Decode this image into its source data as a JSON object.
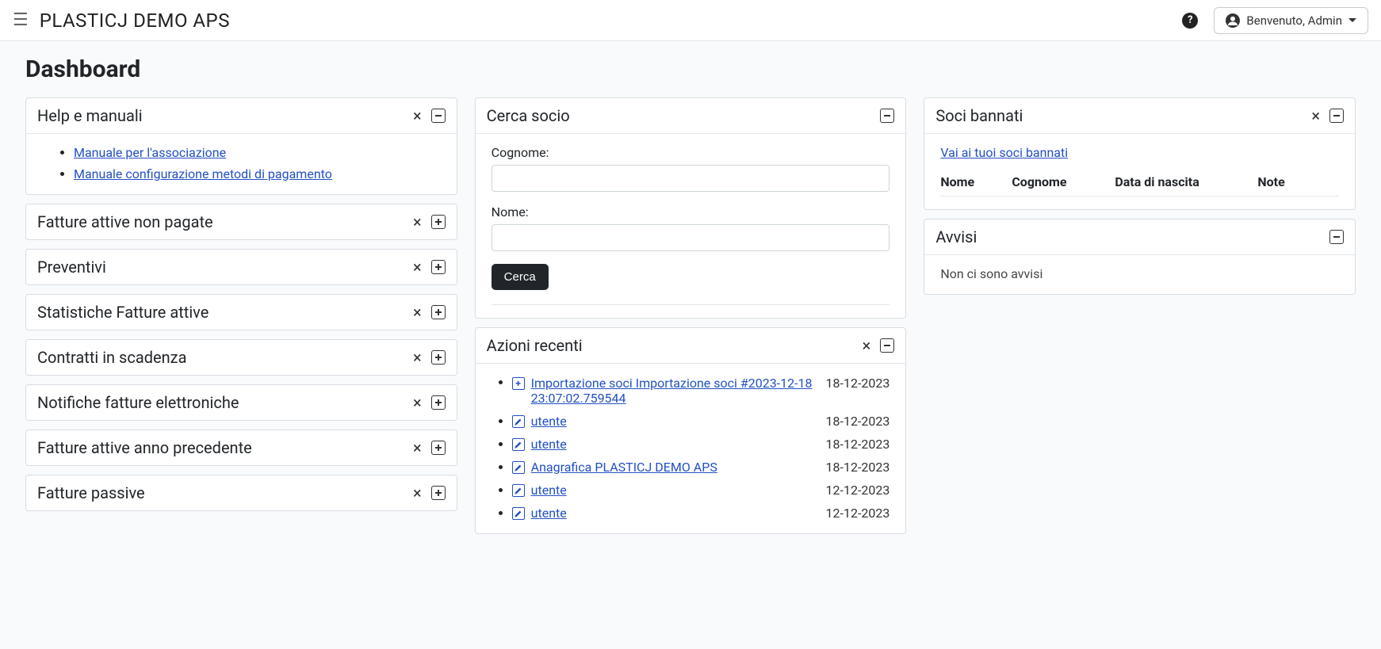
{
  "app_title": "PLASTICJ DEMO APS",
  "user_greeting": "Benvenuto, Admin",
  "page_heading": "Dashboard",
  "panels": {
    "help": {
      "title": "Help e manuali",
      "links": [
        "Manuale per l'associazione",
        "Manuale configurazione metodi di pagamento"
      ]
    },
    "collapsed": [
      "Fatture attive non pagate",
      "Preventivi",
      "Statistiche Fatture attive",
      "Contratti in scadenza",
      "Notifiche fatture elettroniche",
      "Fatture attive anno precedente",
      "Fatture passive"
    ],
    "search_member": {
      "title": "Cerca socio",
      "label_surname": "Cognome:",
      "label_name": "Nome:",
      "button": "Cerca"
    },
    "recent_actions": {
      "title": "Azioni recenti",
      "items": [
        {
          "icon": "add",
          "label": "Importazione soci Importazione soci #2023-12-18 23:07:02.759544",
          "date": "18-12-2023"
        },
        {
          "icon": "edit",
          "label": "utente",
          "date": "18-12-2023"
        },
        {
          "icon": "edit",
          "label": "utente",
          "date": "18-12-2023"
        },
        {
          "icon": "edit",
          "label": "Anagrafica PLASTICJ DEMO APS",
          "date": "18-12-2023"
        },
        {
          "icon": "edit",
          "label": "utente",
          "date": "12-12-2023"
        },
        {
          "icon": "edit",
          "label": "utente",
          "date": "12-12-2023"
        }
      ]
    },
    "banned": {
      "title": "Soci bannati",
      "link": "Vai ai tuoi soci bannati",
      "columns": {
        "name": "Nome",
        "surname": "Cognome",
        "dob": "Data di nascita",
        "notes": "Note"
      }
    },
    "notices": {
      "title": "Avvisi",
      "empty": "Non ci sono avvisi"
    }
  }
}
